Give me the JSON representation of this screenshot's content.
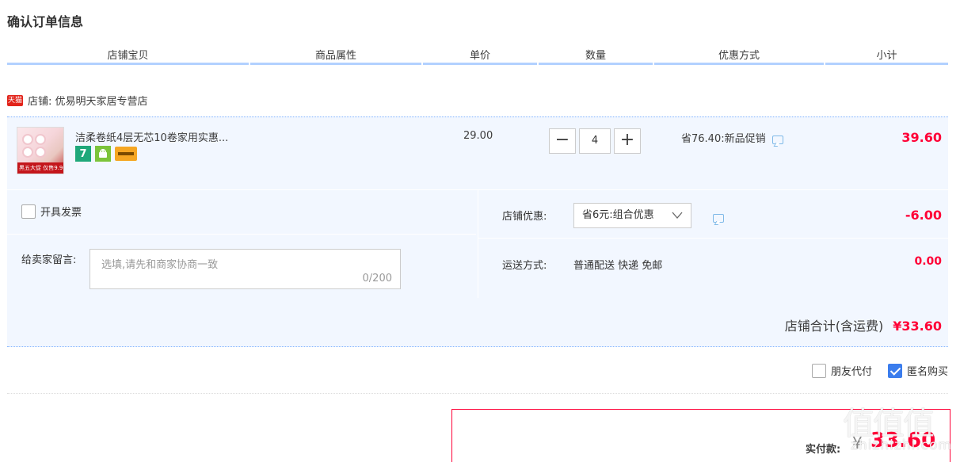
{
  "page_title": "确认订单信息",
  "columns": [
    "店铺宝贝",
    "商品属性",
    "单价",
    "数量",
    "优惠方式",
    "小计"
  ],
  "shop": {
    "badge": "天猫",
    "label": "店铺: 优易明天家居专营店"
  },
  "item": {
    "title": "洁柔卷纸4层无芯10卷家用实惠...",
    "thumb_banner": "黑五大促 仅售9.9元",
    "badge_seven": "7",
    "unit_price": "29.00",
    "qty_minus": "−",
    "qty_value": "4",
    "qty_plus": "+",
    "promo": "省76.40:新品促销",
    "subtotal": "39.60"
  },
  "invoice": {
    "label": "开具发票"
  },
  "message": {
    "label": "给卖家留言:",
    "placeholder": "选填,请先和商家协商一致",
    "count": "0/200"
  },
  "shop_discount": {
    "label": "店铺优惠:",
    "selected": "省6元:组合优惠",
    "amount": "-6.00"
  },
  "shipping": {
    "label": "运送方式:",
    "value": "普通配送 快递 免邮",
    "amount": "0.00"
  },
  "shop_total": {
    "label": "店铺合计(含运费)",
    "amount": "¥33.60"
  },
  "extra": {
    "friend_pay": "朋友代付",
    "anonymous": "匿名购买"
  },
  "payment": {
    "label": "实付款:",
    "currency": "¥",
    "amount": "33.60"
  },
  "watermark": {
    "big": "值值值",
    "small": "zhizhizhi.com"
  },
  "colors": {
    "price_red": "#ff0036",
    "header_rule": "#b2d1ff",
    "row_bg": "#f2f7ff",
    "check_blue": "#3b7ded"
  }
}
